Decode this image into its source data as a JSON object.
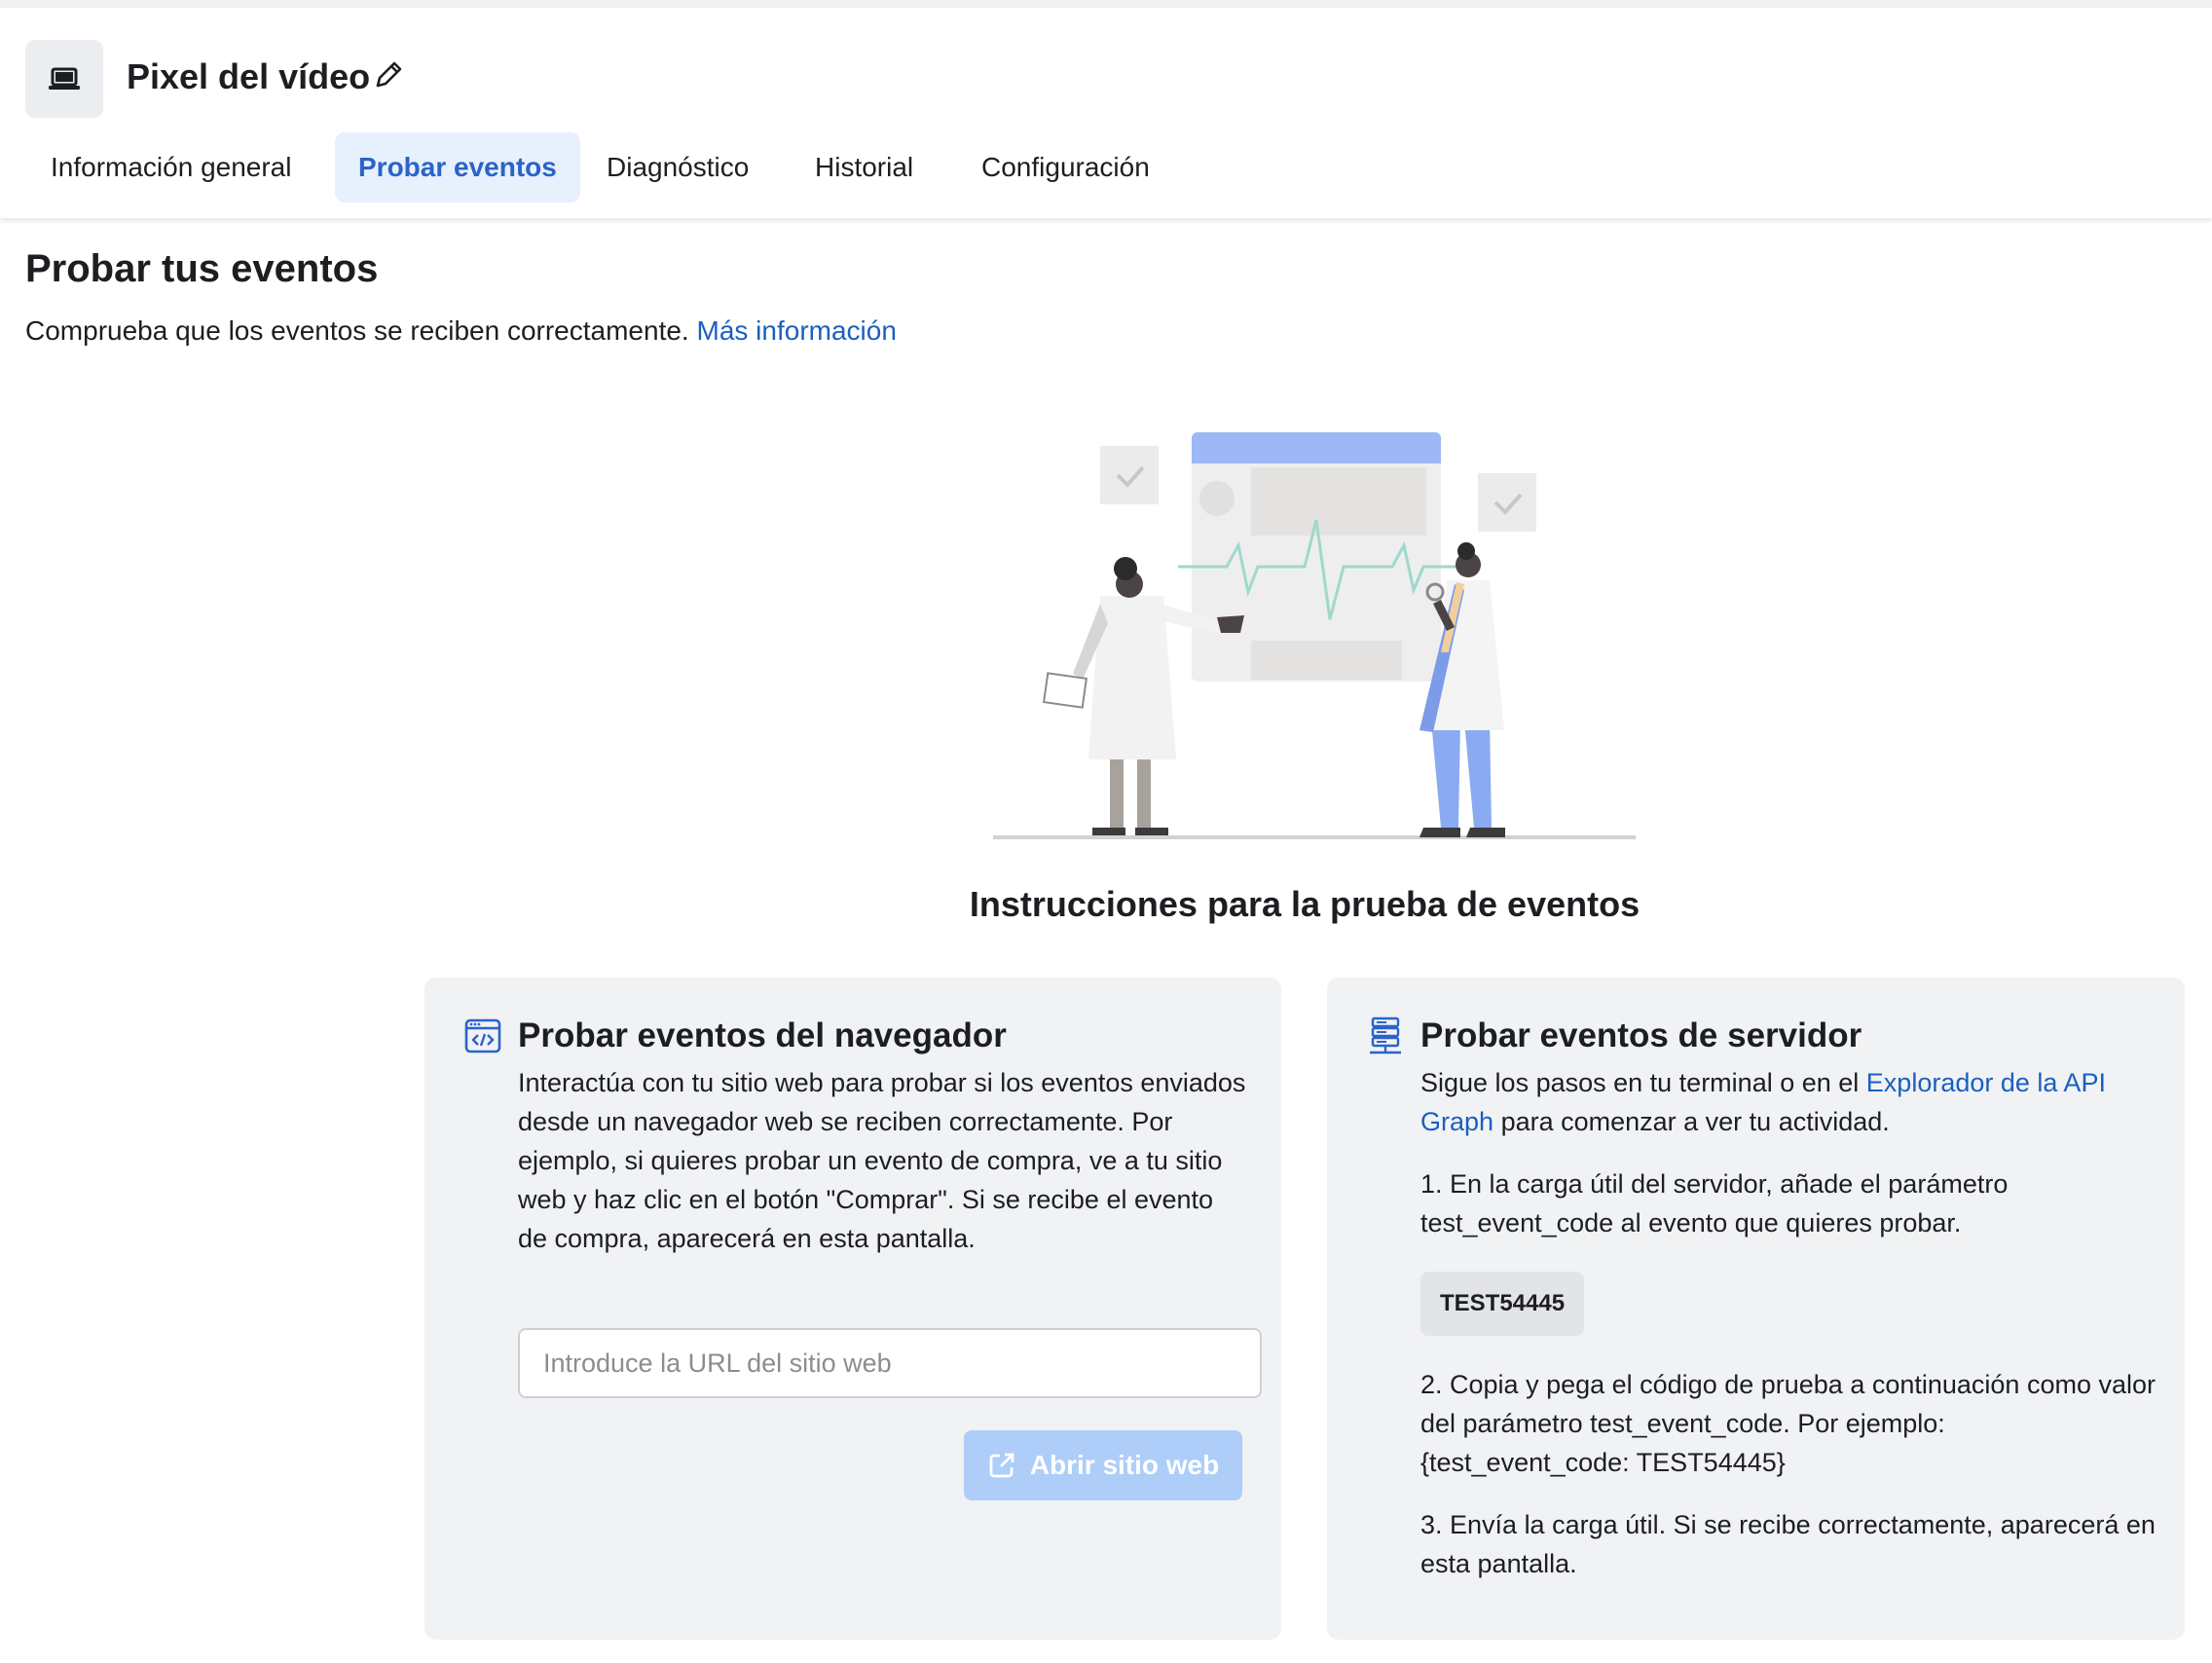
{
  "header": {
    "title": "Pixel del vídeo",
    "tabs": [
      {
        "label": "Información general"
      },
      {
        "label": "Probar eventos"
      },
      {
        "label": "Diagnóstico"
      },
      {
        "label": "Historial"
      },
      {
        "label": "Configuración"
      }
    ],
    "active_tab": "Probar eventos"
  },
  "main": {
    "title": "Probar tus eventos",
    "subtitle": "Comprueba que los eventos se reciben correctamente.",
    "subtitle_link": "Más información",
    "instructions_title": "Instrucciones para la prueba de eventos"
  },
  "browser_card": {
    "title": "Probar eventos del navegador",
    "description": "Interactúa con tu sitio web para probar si los eventos enviados desde un navegador web se reciben correctamente. Por ejemplo, si quieres probar un evento de compra, ve a tu sitio web y haz clic en el botón \"Comprar\". Si se recibe el evento de compra, aparecerá en esta pantalla.",
    "url_placeholder": "Introduce la URL del sitio web",
    "url_value": "",
    "open_button": "Abrir sitio web"
  },
  "server_card": {
    "title": "Probar eventos de servidor",
    "intro_before": "Sigue los pasos en tu terminal o en el",
    "intro_link": "Explorador de la API Graph",
    "intro_after": "para comenzar a ver tu actividad.",
    "step1": "1. En la carga útil del servidor, añade el parámetro test_event_code al evento que quieres probar.",
    "test_code": "TEST54445",
    "step2": "2. Copia y pega el código de prueba a continuación como valor del parámetro test_event_code. Por ejemplo: {test_event_code: TEST54445}",
    "step3": "3. Envía la carga útil. Si se recibe correctamente, aparecerá en esta pantalla."
  },
  "icons": {
    "app": "laptop-icon",
    "edit": "pencil-icon",
    "browser": "browser-code-icon",
    "server": "server-icon",
    "open": "external-link-icon"
  },
  "colors": {
    "accent": "#2a63c9",
    "link": "#1b5fbf",
    "active_tab_bg": "#e7f0fd",
    "card_bg": "#f1f2f4",
    "disabled_button": "#aecdf9"
  }
}
